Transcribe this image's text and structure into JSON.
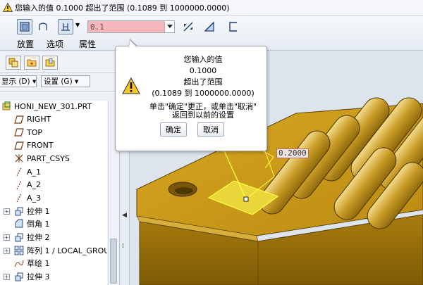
{
  "window": {
    "title": "您输入的值 0.1000 超出了范围 (0.1089 到 1000000.0000)"
  },
  "dashboard": {
    "value_input": "0.1",
    "labels": {
      "placement": "放置",
      "options": "选项",
      "properties": "属性"
    }
  },
  "left_panel": {
    "display_menu": "显示 (D) ▾",
    "settings_menu": "设置 (G) ▾",
    "tree_items": [
      {
        "label": "HONI_NEW_301.PRT",
        "icon": "part-icon"
      },
      {
        "label": "RIGHT",
        "icon": "datum-plane-icon"
      },
      {
        "label": "TOP",
        "icon": "datum-plane-icon"
      },
      {
        "label": "FRONT",
        "icon": "datum-plane-icon"
      },
      {
        "label": "PART_CSYS",
        "icon": "coordinate-system-icon"
      },
      {
        "label": "A_1",
        "icon": "datum-axis-icon"
      },
      {
        "label": "A_2",
        "icon": "datum-axis-icon"
      },
      {
        "label": "A_3",
        "icon": "datum-axis-icon"
      },
      {
        "label": "拉伸 1",
        "icon": "extrude-icon"
      },
      {
        "label": "倒角 1",
        "icon": "chamfer-icon"
      },
      {
        "label": "拉伸 2",
        "icon": "extrude-icon"
      },
      {
        "label": "阵列 1 / LOCAL_GROU",
        "icon": "pattern-icon"
      },
      {
        "label": "草绘 1",
        "icon": "sketch-icon"
      },
      {
        "label": "拉伸 3",
        "icon": "extrude-icon"
      }
    ]
  },
  "dialog": {
    "line1": "您输入的值",
    "line2": "0.1000",
    "line3": "超出了范围",
    "line4": "(0.1089 到 1000000.0000)",
    "line5": "单击\"确定\"更正，或单击\"取消\"",
    "line6": "返回到以前的设置",
    "ok_label": "确定",
    "cancel_label": "取消"
  },
  "viewport": {
    "dimension_label": "0.2000"
  },
  "colors": {
    "model": "#c99a1b",
    "model_dark": "#8a6508",
    "highlight": "#ffff40",
    "input_invalid": "#f4b8bc"
  }
}
